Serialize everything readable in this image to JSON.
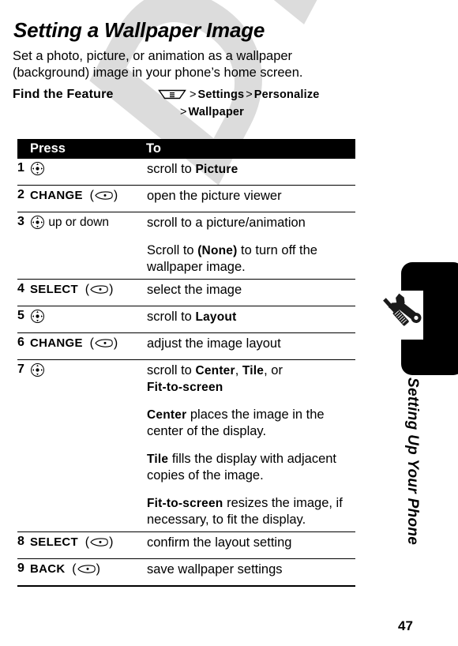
{
  "document": {
    "title": "Setting a Wallpaper Image",
    "intro": "Set a photo, picture, or animation as a wallpaper (background) image in your phone’s home screen.",
    "page_number": "47"
  },
  "find_the_feature": {
    "label": "Find the Feature",
    "menu_icon": "menu-key-icon",
    "separator_1": ">",
    "item_1": "Settings",
    "separator_2": ">",
    "item_2": "Personalize",
    "separator_3": ">",
    "item_3": "Wallpaper"
  },
  "table": {
    "headers": {
      "number": "",
      "press": "Press",
      "to": "To"
    },
    "rows": [
      {
        "num": "1",
        "press_icon": "nav-key-icon",
        "press_label": "",
        "press_suffix": "",
        "to_lines": [
          {
            "plain_before": "scroll to ",
            "bold": "Picture",
            "plain_after": ""
          }
        ]
      },
      {
        "num": "2",
        "press_icon": "soft-key-icon",
        "press_label": "CHANGE",
        "press_suffix": "",
        "to_lines": [
          {
            "plain_before": "open the picture viewer",
            "bold": "",
            "plain_after": ""
          }
        ]
      },
      {
        "num": "3",
        "press_icon": "nav-key-icon",
        "press_label": "",
        "press_suffix": "up or down",
        "to_lines": [
          {
            "plain_before": "scroll to a picture/animation",
            "bold": "",
            "plain_after": ""
          },
          {
            "plain_before": "Scroll to ",
            "bold": "(None)",
            "plain_after": " to turn off the wallpaper image."
          }
        ]
      },
      {
        "num": "4",
        "press_icon": "soft-key-icon",
        "press_label": "SELECT",
        "press_suffix": "",
        "to_lines": [
          {
            "plain_before": "select the image",
            "bold": "",
            "plain_after": ""
          }
        ]
      },
      {
        "num": "5",
        "press_icon": "nav-key-icon",
        "press_label": "",
        "press_suffix": "",
        "to_lines": [
          {
            "plain_before": "scroll to ",
            "bold": "Layout",
            "plain_after": ""
          }
        ]
      },
      {
        "num": "6",
        "press_icon": "soft-key-icon",
        "press_label": "CHANGE",
        "press_suffix": "",
        "to_lines": [
          {
            "plain_before": "adjust the image layout",
            "bold": "",
            "plain_after": ""
          }
        ]
      },
      {
        "num": "7",
        "press_icon": "nav-key-icon",
        "press_label": "",
        "press_suffix": "",
        "to_lines": [
          {
            "plain_before": "scroll to ",
            "bold": "Center",
            "plain_after": ", ",
            "bold2": "Tile",
            "plain_after2": ", or ",
            "bold3": "Fit-to-screen",
            "plain_after3": ""
          },
          {
            "plain_before": "",
            "bold": "Center",
            "plain_after": " places the image in the center of the display."
          },
          {
            "plain_before": "",
            "bold": "Tile",
            "plain_after": " fills the display with adjacent copies of the image."
          },
          {
            "plain_before": "",
            "bold": "Fit-to-screen",
            "plain_after": " resizes the image, if necessary, to fit the display."
          }
        ]
      },
      {
        "num": "8",
        "press_icon": "soft-key-icon",
        "press_label": "SELECT",
        "press_suffix": "",
        "to_lines": [
          {
            "plain_before": "confirm the layout setting",
            "bold": "",
            "plain_after": ""
          }
        ]
      },
      {
        "num": "9",
        "press_icon": "soft-key-icon",
        "press_label": "BACK",
        "press_suffix": "",
        "to_lines": [
          {
            "plain_before": "save wallpaper settings",
            "bold": "",
            "plain_after": ""
          }
        ]
      }
    ]
  },
  "side_tab": {
    "label": "Setting Up Your Phone",
    "icon": "wrench-screwdriver-icon",
    "color": "#000000"
  },
  "watermark": {
    "text": "DRAFT",
    "color": "#dcdcdc"
  }
}
